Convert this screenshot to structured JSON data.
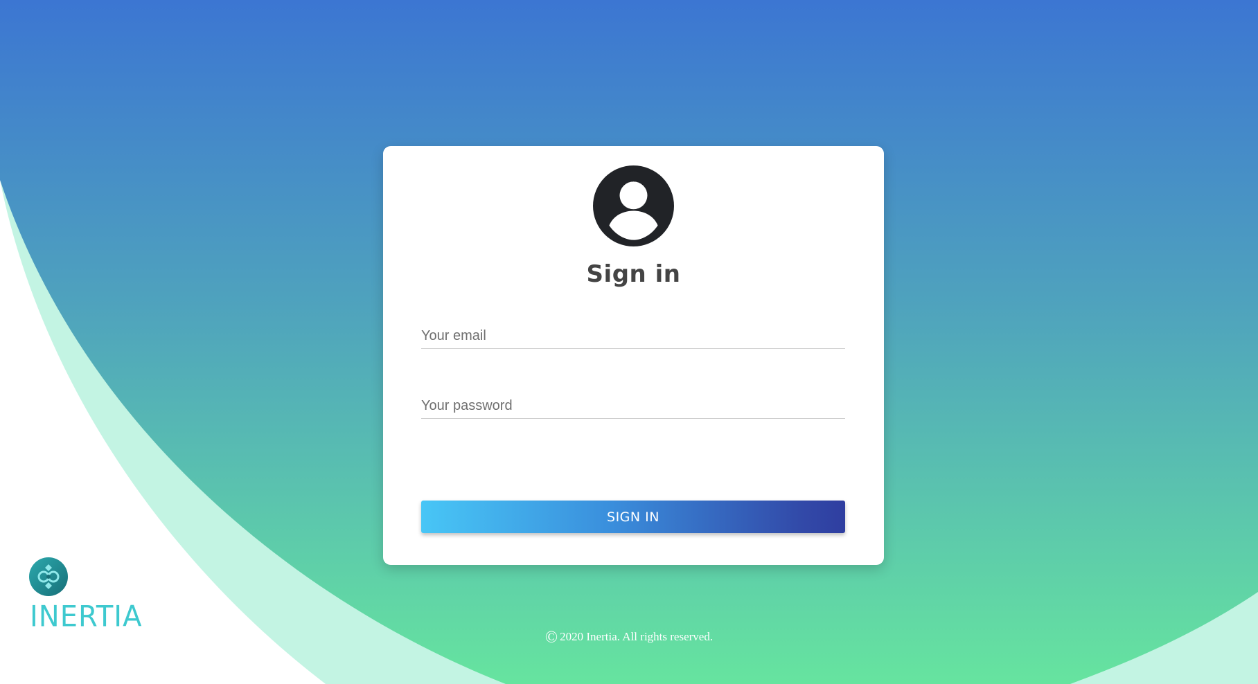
{
  "colors": {
    "gradient_top": "#3c76d2",
    "gradient_bottom": "#66e49f",
    "outer_band": "#c3f4e3",
    "button_start": "#48c6f6",
    "button_end": "#2f3ea0",
    "brand": "#3ec9cf"
  },
  "card": {
    "avatar_icon": "user-circle-icon",
    "title": "Sign in",
    "email": {
      "placeholder": "Your email",
      "value": ""
    },
    "password": {
      "placeholder": "Your password",
      "value": ""
    },
    "submit_label": "SIGN IN"
  },
  "brand": {
    "icon": "inertia-logo-icon",
    "name": "INERTIA"
  },
  "footer": {
    "copyright_symbol": "©",
    "text": "2020 Inertia. All rights reserved."
  }
}
